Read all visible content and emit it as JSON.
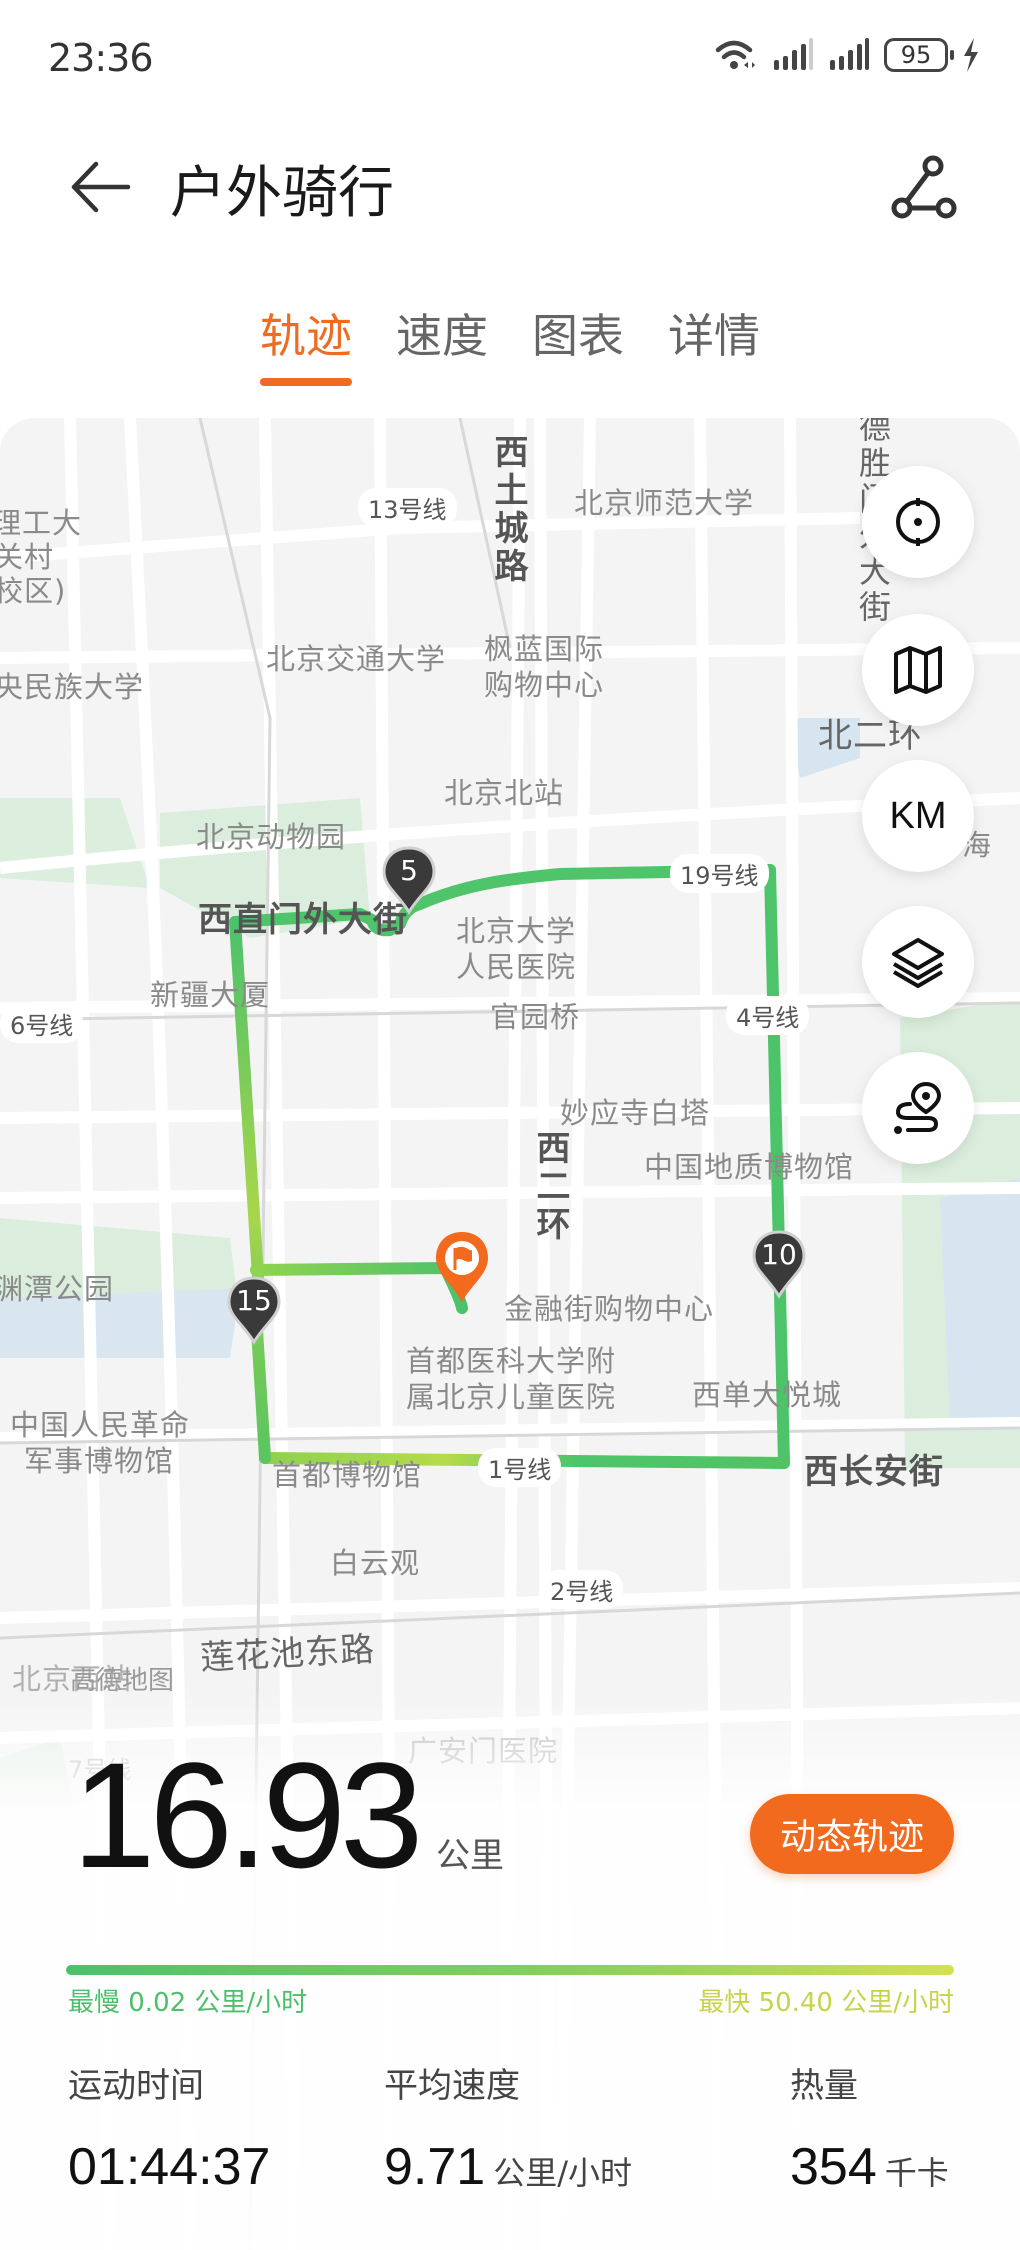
{
  "status": {
    "time": "23:36",
    "battery": "95"
  },
  "header": {
    "title": "户外骑行"
  },
  "tabs": [
    {
      "label": "轨迹",
      "active": true
    },
    {
      "label": "速度",
      "active": false
    },
    {
      "label": "图表",
      "active": false
    },
    {
      "label": "详情",
      "active": false
    }
  ],
  "map": {
    "provider_watermark": "高德地图",
    "controls": {
      "locate": "locate-icon",
      "map_style": "map-icon",
      "unit": "KM",
      "layers": "layers-icon",
      "route": "route-icon"
    },
    "km_markers": [
      "5",
      "10",
      "15"
    ],
    "labels": {
      "bit_1": "理工大",
      "bit_2": "关村",
      "bit_3": "校区)",
      "minzu": "央民族大学",
      "line13": "13号线",
      "xitucheng": "西土城路",
      "bnu": "北京师范大学",
      "deshengmen": "德胜门外大街",
      "bjtu": "北京交通大学",
      "fenglan_1": "枫蓝国际",
      "fenglan_2": "购物中心",
      "beierhuan": "北二环",
      "beijingbei": "北京北站",
      "zoo": "北京动物园",
      "hai": "海",
      "line19": "19号线",
      "xizhimen": "西直门外大街",
      "pku_1": "北京大学",
      "pku_2": "人民医院",
      "xinjiang": "新疆大厦",
      "line6": "6号线",
      "guanyuan": "官园桥",
      "line4": "4号线",
      "miaoying": "妙应寺白塔",
      "xierhuan": "西二环",
      "geo_museum": "中国地质博物馆",
      "yuyuantan": "渊潭公园",
      "jinrongjie": "金融街购物中心",
      "children_1": "首都医科大学附",
      "children_2": "属北京儿童医院",
      "joycity": "西单大悦城",
      "military_1": "中国人民革命",
      "military_2": "军事博物馆",
      "capital_museum": "首都博物馆",
      "line1": "1号线",
      "xichangan": "西长安街",
      "baiyunguan": "白云观",
      "line2": "2号线",
      "lianhuachi": "莲花池东路",
      "westrail": "北京西站",
      "line7": "7号线",
      "guanganmen": "广安门医院"
    }
  },
  "summary": {
    "distance": "16.93",
    "distance_unit": "公里",
    "dynamic_track_button": "动态轨迹",
    "speed_min": "最慢 0.02 公里/小时",
    "speed_max": "最快 50.40 公里/小时",
    "stats": [
      {
        "label": "运动时间",
        "value": "01:44:37",
        "unit": ""
      },
      {
        "label": "平均速度",
        "value": "9.71",
        "unit": "公里/小时"
      },
      {
        "label": "热量",
        "value": "354",
        "unit": "千卡"
      }
    ]
  },
  "colors": {
    "accent": "#ee6b23",
    "track_slow": "#4cc16b",
    "track_fast": "#d5e052",
    "marker": "#3a3a3a"
  }
}
